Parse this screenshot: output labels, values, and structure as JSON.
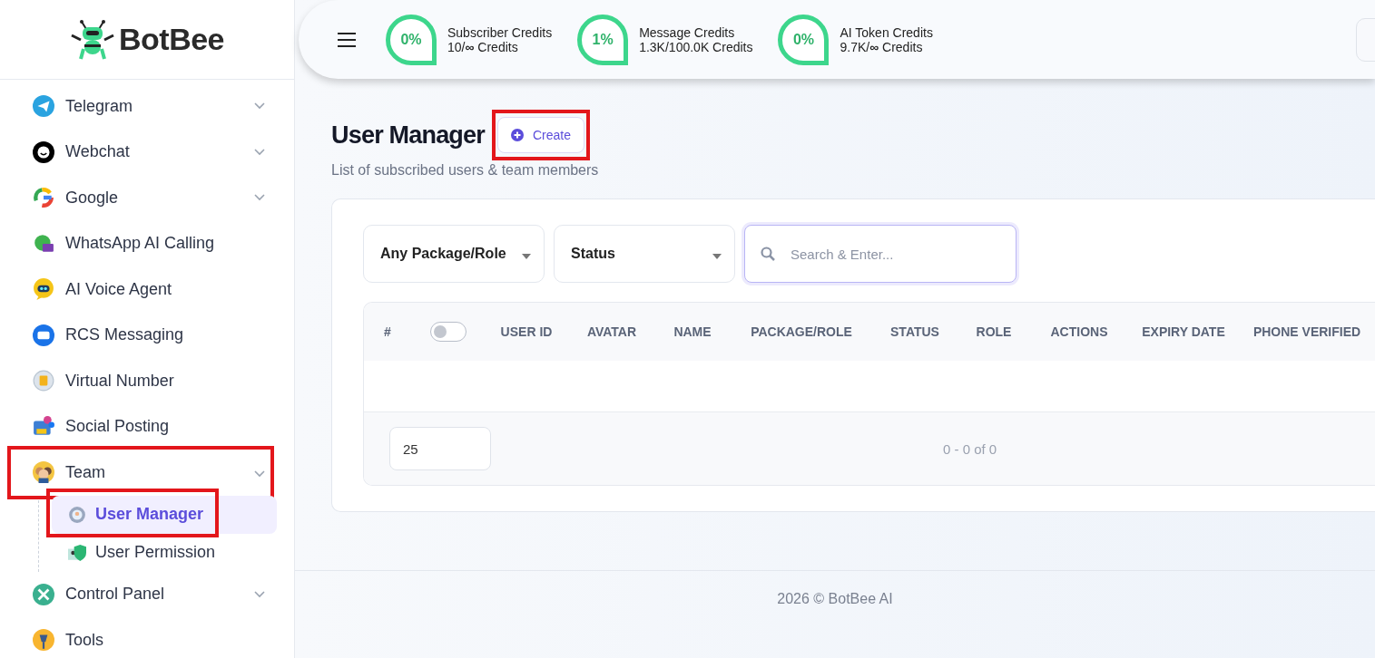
{
  "brand": {
    "name": "BotBee"
  },
  "sidebar": {
    "items": [
      {
        "label": "Telegram",
        "expandable": true
      },
      {
        "label": "Webchat",
        "expandable": true
      },
      {
        "label": "Google",
        "expandable": true
      },
      {
        "label": "WhatsApp AI Calling",
        "expandable": false
      },
      {
        "label": "AI Voice Agent",
        "expandable": false
      },
      {
        "label": "RCS Messaging",
        "expandable": false
      },
      {
        "label": "Virtual Number",
        "expandable": false
      },
      {
        "label": "Social Posting",
        "expandable": false
      },
      {
        "label": "Team",
        "expandable": true,
        "expanded": true,
        "highlighted": true,
        "children": [
          {
            "label": "User Manager",
            "selected": true,
            "highlighted": true
          },
          {
            "label": "User Permission",
            "selected": false
          }
        ]
      },
      {
        "label": "Control Panel",
        "expandable": true
      },
      {
        "label": "Tools",
        "expandable": false
      }
    ]
  },
  "credits": [
    {
      "percent": "0%",
      "title": "Subscriber Credits",
      "usage": "10/**∞** Credits"
    },
    {
      "percent": "1%",
      "title": "Message Credits",
      "usage": "1.3K/100.0K Credits"
    },
    {
      "percent": "0%",
      "title": "AI Token Credits",
      "usage": "9.7K/**∞** Credits"
    }
  ],
  "page": {
    "title": "User Manager",
    "create_button": {
      "label": "Create",
      "highlighted": true
    },
    "subtitle": "List of subscribed users & team members"
  },
  "filters": [
    {
      "label": "Any Package/Role"
    },
    {
      "label": "Status"
    }
  ],
  "search": {
    "placeholder": "Search & Enter..."
  },
  "table": {
    "select_all": {
      "checked": false
    },
    "columns": [
      "#",
      "",
      "USER ID",
      "AVATAR",
      "NAME",
      "PACKAGE/ROLE",
      "STATUS",
      "ROLE",
      "ACTIONS",
      "EXPIRY DATE",
      "PHONE VERIFIED"
    ]
  },
  "pagination": {
    "page_size": "25",
    "range": "0 - 0 of 0"
  },
  "footer": {
    "text": "2026 © BotBee AI"
  }
}
